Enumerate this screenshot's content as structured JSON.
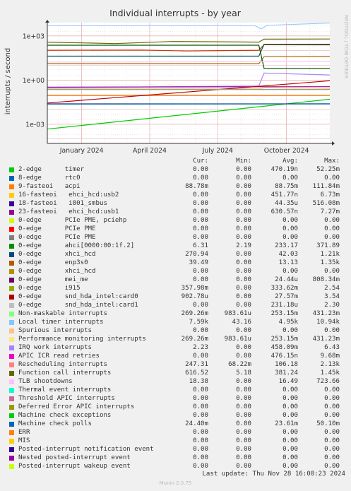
{
  "chart_data": {
    "type": "line",
    "title": "Individual interrupts - by year",
    "ylabel": "interrupts / second",
    "watermark": "RRDTOOL / TOBI OETIKER",
    "yscale": "log",
    "ylim": [
      5e-05,
      8000
    ],
    "y_ticks": [
      {
        "value": 1000,
        "label": "1e+03"
      },
      {
        "value": 1,
        "label": "1e+00"
      },
      {
        "value": 0.001,
        "label": "1e-03"
      }
    ],
    "xlim": [
      "2023-11-16",
      "2024-11-28"
    ],
    "x_ticks": [
      {
        "date": "2024-01-01",
        "label": "January 2024"
      },
      {
        "date": "2024-04-01",
        "label": "April 2024"
      },
      {
        "date": "2024-07-01",
        "label": "July 2024"
      },
      {
        "date": "2024-10-01",
        "label": "October 2024"
      }
    ],
    "grid": true,
    "series": [
      {
        "name": "Local timer interrupts",
        "color": "#99ccff",
        "y_points": [
          [
            "2023-11-16",
            4950
          ],
          [
            "2024-08-20",
            4950
          ],
          [
            "2024-08-28",
            3000
          ],
          [
            "2024-09-05",
            5200
          ],
          [
            "2024-11-28",
            7590
          ]
        ]
      },
      {
        "name": "Rescheduling interrupts",
        "color": "#cc3300",
        "y_points": [
          [
            "2023-11-16",
            106
          ],
          [
            "2024-03-20",
            110
          ],
          [
            "2024-05-20",
            95
          ],
          [
            "2024-08-25",
            106
          ],
          [
            "2024-09-01",
            250
          ],
          [
            "2024-11-28",
            247
          ]
        ]
      },
      {
        "name": "Function call interrupts",
        "color": "#666600",
        "y_points": [
          [
            "2023-11-16",
            381
          ],
          [
            "2024-02-15",
            300
          ],
          [
            "2024-05-01",
            420
          ],
          [
            "2024-08-25",
            381
          ],
          [
            "2024-09-01",
            600
          ],
          [
            "2024-11-28",
            616
          ]
        ]
      },
      {
        "name": "xhci_hcd",
        "color": "#005b4f",
        "y_points": [
          [
            "2023-11-16",
            42
          ],
          [
            "2024-08-25",
            42
          ],
          [
            "2024-09-01",
            270
          ],
          [
            "2024-11-28",
            271
          ]
        ]
      },
      {
        "name": "enp3s0",
        "color": "#aa6600",
        "y_points": [
          [
            "2023-11-16",
            13
          ],
          [
            "2024-08-25",
            13
          ],
          [
            "2024-09-01",
            39
          ],
          [
            "2024-11-28",
            39.5
          ]
        ]
      },
      {
        "name": "ahci[0000:00:1f.2]",
        "color": "#005500",
        "y_points": [
          [
            "2023-11-16",
            233
          ],
          [
            "2024-08-25",
            233
          ],
          [
            "2024-09-01",
            6.3
          ],
          [
            "2024-11-28",
            6.31
          ]
        ]
      },
      {
        "name": "IRQ work interrupts",
        "color": "#aa88ff",
        "y_points": [
          [
            "2023-11-16",
            0.3
          ],
          [
            "2024-08-25",
            0.4
          ],
          [
            "2024-09-01",
            3
          ],
          [
            "2024-11-28",
            2.23
          ]
        ]
      },
      {
        "name": "Non-maskable interrupts",
        "color": "#88dd55",
        "y_points": [
          [
            "2023-11-16",
            0.25
          ],
          [
            "2024-08-25",
            0.25
          ],
          [
            "2024-09-01",
            0.3
          ],
          [
            "2024-11-28",
            0.27
          ]
        ]
      },
      {
        "name": "Performance monitoring interrupts",
        "color": "#ffcc66",
        "y_points": [
          [
            "2023-11-16",
            0.25
          ],
          [
            "2024-08-25",
            0.25
          ],
          [
            "2024-09-01",
            0.3
          ],
          [
            "2024-11-28",
            0.27
          ]
        ]
      },
      {
        "name": "timer",
        "color": "#00cc00",
        "y_points": [
          [
            "2023-11-16",
            0.00047
          ],
          [
            "2024-11-28",
            0.05
          ]
        ]
      },
      {
        "name": "mei_me",
        "color": "#330099",
        "y_points": [
          [
            "2023-11-16",
            0.0244
          ],
          [
            "2024-11-28",
            0.0244
          ]
        ]
      },
      {
        "name": "Machine check polls",
        "color": "#006699",
        "y_points": [
          [
            "2023-11-16",
            0.0236
          ],
          [
            "2024-11-28",
            0.0244
          ]
        ]
      },
      {
        "name": "acpi",
        "color": "#ff8000",
        "y_points": [
          [
            "2023-11-16",
            0.0888
          ],
          [
            "2024-11-28",
            0.0888
          ]
        ]
      },
      {
        "name": "i915",
        "color": "#990099",
        "y_points": [
          [
            "2023-11-16",
            0.3336
          ],
          [
            "2024-11-28",
            0.358
          ]
        ]
      },
      {
        "name": "snd_hda_intel:card0",
        "color": "#bb0000",
        "y_points": [
          [
            "2023-11-16",
            0.0276
          ],
          [
            "2024-11-28",
            0.903
          ]
        ]
      },
      {
        "name": "snd_hda_intel:card1",
        "color": "#999999",
        "y_points": [
          [
            "2023-11-16",
            0.2312
          ],
          [
            "2024-11-28",
            0.2312
          ]
        ]
      },
      {
        "name": "TLB shootdowns",
        "color": "#ffccff",
        "y_points": [
          [
            "2023-11-16",
            16.5
          ],
          [
            "2024-11-28",
            18.4
          ]
        ]
      }
    ],
    "legend": {
      "headers": [
        "",
        "Cur:",
        "Min:",
        "Avg:",
        "Max:"
      ],
      "rows": [
        {
          "name": "2-edge      timer",
          "color": "#00cc00",
          "cur": "0.00",
          "min": "0.00",
          "avg": "470.19n",
          "max": "52.25m"
        },
        {
          "name": "8-edge      rtc0",
          "color": "#0066b3",
          "cur": "0.00",
          "min": "0.00",
          "avg": "0.00",
          "max": "0.00"
        },
        {
          "name": "9-fasteoi   acpi",
          "color": "#ff8000",
          "cur": "88.78m",
          "min": "0.00",
          "avg": "88.75m",
          "max": "111.84m"
        },
        {
          "name": "16-fasteoi   ehci_hcd:usb2",
          "color": "#ffcc00",
          "cur": "0.00",
          "min": "0.00",
          "avg": "451.77n",
          "max": "6.73m"
        },
        {
          "name": "18-fasteoi   i801_smbus",
          "color": "#330099",
          "cur": "0.00",
          "min": "0.00",
          "avg": "44.35u",
          "max": "516.08m"
        },
        {
          "name": "23-fasteoi   ehci_hcd:usb1",
          "color": "#990099",
          "cur": "0.00",
          "min": "0.00",
          "avg": "630.57n",
          "max": "7.27m"
        },
        {
          "name": "0-edge      PCIe PME, pciehp",
          "color": "#ccff00",
          "cur": "0.00",
          "min": "0.00",
          "avg": "0.00",
          "max": "0.00"
        },
        {
          "name": "0-edge      PCIe PME",
          "color": "#ff0000",
          "cur": "0.00",
          "min": "0.00",
          "avg": "0.00",
          "max": "0.00"
        },
        {
          "name": "0-edge      PCIe PME",
          "color": "#808080",
          "cur": "0.00",
          "min": "0.00",
          "avg": "0.00",
          "max": "0.00"
        },
        {
          "name": "0-edge      ahci[0000:00:1f.2]",
          "color": "#008f00",
          "cur": "6.31",
          "min": "2.19",
          "avg": "233.17",
          "max": "371.89"
        },
        {
          "name": "0-edge      xhci_hcd",
          "color": "#00487d",
          "cur": "270.94",
          "min": "0.00",
          "avg": "42.03",
          "max": "1.21k"
        },
        {
          "name": "0-edge      enp3s0",
          "color": "#b35a00",
          "cur": "39.49",
          "min": "0.00",
          "avg": "13.13",
          "max": "1.35k"
        },
        {
          "name": "0-edge      xhci_hcd",
          "color": "#b38f00",
          "cur": "0.00",
          "min": "0.00",
          "avg": "0.00",
          "max": "0.00"
        },
        {
          "name": "0-edge      mei_me",
          "color": "#6b006b",
          "cur": "0.00",
          "min": "0.00",
          "avg": "24.44u",
          "max": "808.34m"
        },
        {
          "name": "0-edge      i915",
          "color": "#8fb300",
          "cur": "357.98m",
          "min": "0.00",
          "avg": "333.62m",
          "max": "2.54"
        },
        {
          "name": "0-edge      snd_hda_intel:card0",
          "color": "#b30000",
          "cur": "902.78u",
          "min": "0.00",
          "avg": "27.57m",
          "max": "3.54"
        },
        {
          "name": "0-edge      snd_hda_intel:card1",
          "color": "#bebebe",
          "cur": "0.00",
          "min": "0.00",
          "avg": "231.18u",
          "max": "2.30"
        },
        {
          "name": "Non-maskable interrupts",
          "color": "#80ff80",
          "cur": "269.26m",
          "min": "983.61u",
          "avg": "253.15m",
          "max": "431.23m"
        },
        {
          "name": "Local timer interrupts",
          "color": "#80c9ff",
          "cur": "7.59k",
          "min": "43.16",
          "avg": "4.95k",
          "max": "10.94k"
        },
        {
          "name": "Spurious interrupts",
          "color": "#ffc080",
          "cur": "0.00",
          "min": "0.00",
          "avg": "0.00",
          "max": "0.00"
        },
        {
          "name": "Performance monitoring interrupts",
          "color": "#ffe680",
          "cur": "269.26m",
          "min": "983.61u",
          "avg": "253.15m",
          "max": "431.23m"
        },
        {
          "name": "IRQ work interrupts",
          "color": "#aa80ff",
          "cur": "2.23",
          "min": "0.00",
          "avg": "458.09m",
          "max": "6.43"
        },
        {
          "name": "APIC ICR read retries",
          "color": "#ee00cc",
          "cur": "0.00",
          "min": "0.00",
          "avg": "476.15n",
          "max": "9.68m"
        },
        {
          "name": "Rescheduling interrupts",
          "color": "#ff8080",
          "cur": "247.31",
          "min": "68.22m",
          "avg": "106.18",
          "max": "2.13k"
        },
        {
          "name": "Function call interrupts",
          "color": "#666600",
          "cur": "616.52",
          "min": "5.18",
          "avg": "381.24",
          "max": "1.45k"
        },
        {
          "name": "TLB shootdowns",
          "color": "#ffbfff",
          "cur": "18.38",
          "min": "0.00",
          "avg": "16.49",
          "max": "723.66"
        },
        {
          "name": "Thermal event interrupts",
          "color": "#00ffcc",
          "cur": "0.00",
          "min": "0.00",
          "avg": "0.00",
          "max": "0.00"
        },
        {
          "name": "Threshold APIC interrupts",
          "color": "#cc6699",
          "cur": "0.00",
          "min": "0.00",
          "avg": "0.00",
          "max": "0.00"
        },
        {
          "name": "Deferred Error APIC interrupts",
          "color": "#999900",
          "cur": "0.00",
          "min": "0.00",
          "avg": "0.00",
          "max": "0.00"
        },
        {
          "name": "Machine check exceptions",
          "color": "#00cc00",
          "cur": "0.00",
          "min": "0.00",
          "avg": "0.00",
          "max": "0.00"
        },
        {
          "name": "Machine check polls",
          "color": "#0066b3",
          "cur": "24.40m",
          "min": "0.00",
          "avg": "23.61m",
          "max": "50.10m"
        },
        {
          "name": "ERR",
          "color": "#ff8000",
          "cur": "0.00",
          "min": "0.00",
          "avg": "0.00",
          "max": "0.00"
        },
        {
          "name": "MIS",
          "color": "#ffcc00",
          "cur": "0.00",
          "min": "0.00",
          "avg": "0.00",
          "max": "0.00"
        },
        {
          "name": "Posted-interrupt notification event",
          "color": "#330099",
          "cur": "0.00",
          "min": "0.00",
          "avg": "0.00",
          "max": "0.00"
        },
        {
          "name": "Nested posted-interrupt event",
          "color": "#990099",
          "cur": "0.00",
          "min": "0.00",
          "avg": "0.00",
          "max": "0.00"
        },
        {
          "name": "Posted-interrupt wakeup event",
          "color": "#ccff00",
          "cur": "0.00",
          "min": "0.00",
          "avg": "0.00",
          "max": "0.00"
        }
      ]
    }
  },
  "footer": {
    "last_update": "Last update: Thu Nov 28 16:00:23 2024",
    "version": "Munin 2.0.75"
  }
}
